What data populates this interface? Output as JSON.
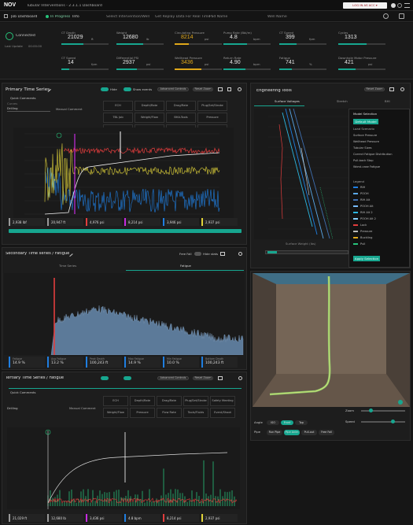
{
  "app": {
    "logo": "NOV",
    "subtitle": "Tubular Interventions - 2.3.1.1 Dashboard",
    "account_button": "LOG IN AS ACC ▾"
  },
  "navbar": {
    "items": [
      "Job Dashboard",
      "In Progress",
      "Info",
      "Select Intervention/Well",
      "Get Replay Data For Real Time",
      "Pad Name",
      "Well Name"
    ]
  },
  "kpis": {
    "status_label": "Connected",
    "status_sub": "Last Update",
    "status_time": "00:00:00",
    "top": [
      {
        "label": "CT Depth",
        "value": "21029",
        "unit": "ft"
      },
      {
        "label": "Weight",
        "value": "12680",
        "unit": "lb"
      },
      {
        "label": "Circulating Pressure",
        "value": "8214",
        "unit": "psi"
      },
      {
        "label": "Pump Rate (Bbl/m)",
        "value": "4.8",
        "unit": "bpm"
      },
      {
        "label": "CT Speed",
        "value": "399",
        "unit": "fpm"
      },
      {
        "label": "Cycles",
        "value": "1313",
        "unit": ""
      }
    ],
    "bottom": [
      {
        "label": "CT Speed",
        "value": "14",
        "unit": "fpm"
      },
      {
        "label": "Differential PSI",
        "value": "2937",
        "unit": "psi"
      },
      {
        "label": "Wellhead Pressure",
        "value": "3436",
        "unit": "psi"
      },
      {
        "label": "Return Rate",
        "value": "4.90",
        "unit": "bpm"
      },
      {
        "label": "Fatigue",
        "value": "741",
        "unit": "%"
      },
      {
        "label": "Downhole Motor Pressure",
        "value": "421",
        "unit": "psi"
      }
    ]
  },
  "primary": {
    "title": "Primary Time Series",
    "toggles": [
      "Hide",
      "Show events",
      "Advanced Controls",
      "Reset Zoom"
    ],
    "section": "Quick Comments",
    "select_label": "Curves",
    "select_value": "Drilling",
    "manual_button": "Manual Comment",
    "grid": [
      "ECH",
      "Depth/Rate",
      "Drag/Rate",
      "Plug/Set/Stroke",
      "TBL Job",
      "Weight/Flow",
      "BHA-Tools",
      "Pressure",
      "TBL Job 2",
      "Weight/Shoot",
      "Pressure/Rate",
      "Pressure/Station"
    ],
    "readings": [
      "2,938 lbf",
      "20,947 ft",
      "4,976 psi",
      "8,214 psi",
      "3,946 psi",
      "2,937 psi"
    ]
  },
  "secondary": {
    "title": "Secondary Time series / Fatigue",
    "tabs": [
      "Time Series",
      "Fatigue"
    ],
    "controls": [
      "Free Fall",
      "Hide stats"
    ],
    "readings": [
      "14.9 %",
      "13.2 %",
      "100,243 ft",
      "14.9 %",
      "10.0 %",
      "100,243 ft"
    ],
    "readings_labels": [
      "Fatigue",
      "Avg Fatigue",
      "Peak Depth",
      "Max Fatigue",
      "Min Fatigue",
      "Bottom Depth"
    ]
  },
  "tertiary": {
    "title": "Tertiary Time Series / Fatigue",
    "section": "Quick Comments",
    "select_value": "Drilling",
    "manual_button": "Manual Comment",
    "grid": [
      "ECH",
      "Depth/Rate",
      "Drag/Rate",
      "Plug/Set/Stroke",
      "Safety Meeting",
      "Weight/Flow",
      "Pressure",
      "Flow Rate",
      "Tools/Fluids",
      "Event/Shoot"
    ],
    "readings": [
      "21,029 ft",
      "12,680 lb",
      "3,436 psi",
      "4.8 bpm",
      "8,214 psi",
      "2,937 psi"
    ]
  },
  "engineering": {
    "title": "Engineering Tools",
    "button": "Reset Zoom",
    "tabs": [
      "Surface Voltages",
      "Stretch",
      "BHI"
    ],
    "bottom_label": "Surface Weight (lbs)",
    "legend_title": "Model Selection",
    "legend_btn": "Default Model",
    "legend_sub": "Load Scenario",
    "legend_rows": [
      "Surface Pressure",
      "Wellhead Pressure",
      "Tubular Sizes",
      "Correct Fatigue Distribution",
      "Pull-back Stop",
      "Worst-case Fatigue"
    ],
    "legend_list_title": "Legend",
    "series_names": [
      "RIH",
      "POOH",
      "RIH Alt",
      "POOH Alt",
      "RIH Alt 2",
      "POOH Alt 2",
      "Lock",
      "Pressure",
      "Buckling",
      "Pull"
    ],
    "apply_btn": "Apply Selection"
  },
  "model3d": {
    "view_label": "Angle",
    "view_options": [
      "ISO",
      "Front",
      "Top"
    ],
    "mode_label": "Pipe",
    "mode_options": [
      "Run Pipe",
      "Pipe Anim",
      "Pull-out",
      "Free Fall"
    ],
    "zoom_label": "Zoom",
    "speed_label": "Speed"
  }
}
